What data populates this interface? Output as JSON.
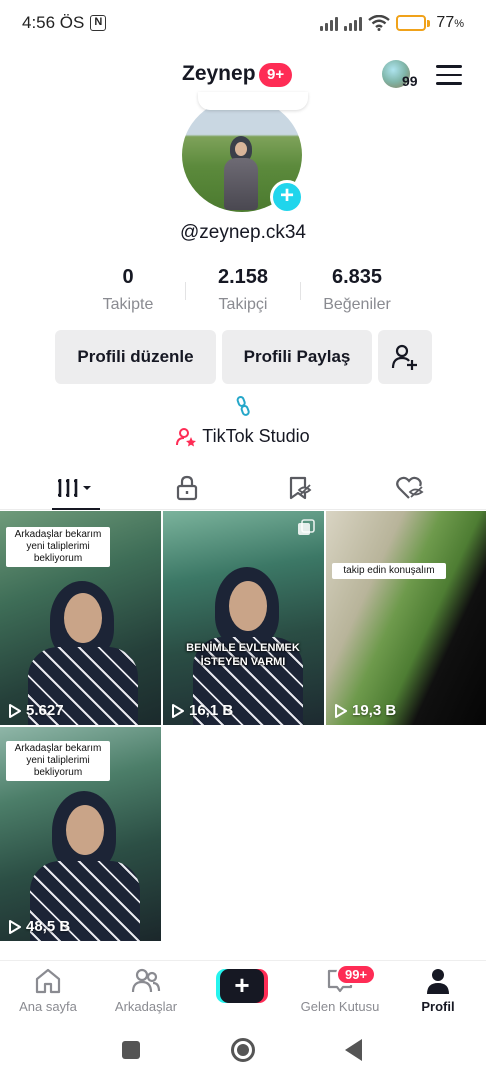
{
  "status_bar": {
    "time": "4:56 ÖS",
    "nfc": "N",
    "battery_percent": "77",
    "battery_suffix": "%",
    "battery_level": 0.77
  },
  "header": {
    "title": "Zeynep",
    "notification_badge": "9+",
    "coin_count": "99"
  },
  "profile": {
    "handle": "@zeynep.ck34"
  },
  "stats": [
    {
      "value": "0",
      "label": "Takipte"
    },
    {
      "value": "2.158",
      "label": "Takipçi"
    },
    {
      "value": "6.835",
      "label": "Beğeniler"
    }
  ],
  "actions": {
    "edit_profile": "Profili düzenle",
    "share_profile": "Profili Paylaş"
  },
  "studio": {
    "label": "TikTok Studio"
  },
  "videos": [
    {
      "views": "5.627",
      "caption": "Arkadaşlar bekarım yeni taliplerimi bekliyorum",
      "overlay": ""
    },
    {
      "views": "16,1 B",
      "caption": "",
      "overlay": "BENİMLE EVLENMEK İSTEYEN VARMI"
    },
    {
      "views": "19,3 B",
      "caption": "takip edin konuşalım",
      "overlay": ""
    },
    {
      "views": "48,5 B",
      "caption": "Arkadaşlar bekarım yeni taliplerimi bekliyorum",
      "overlay": ""
    }
  ],
  "bottom_nav": {
    "home": "Ana sayfa",
    "friends": "Arkadaşlar",
    "inbox": "Gelen Kutusu",
    "inbox_badge": "99+",
    "profile": "Profil"
  },
  "colors": {
    "accent": "#fe2c55",
    "cyan": "#25f4ee",
    "text": "#161823",
    "muted": "#8a8b91"
  }
}
